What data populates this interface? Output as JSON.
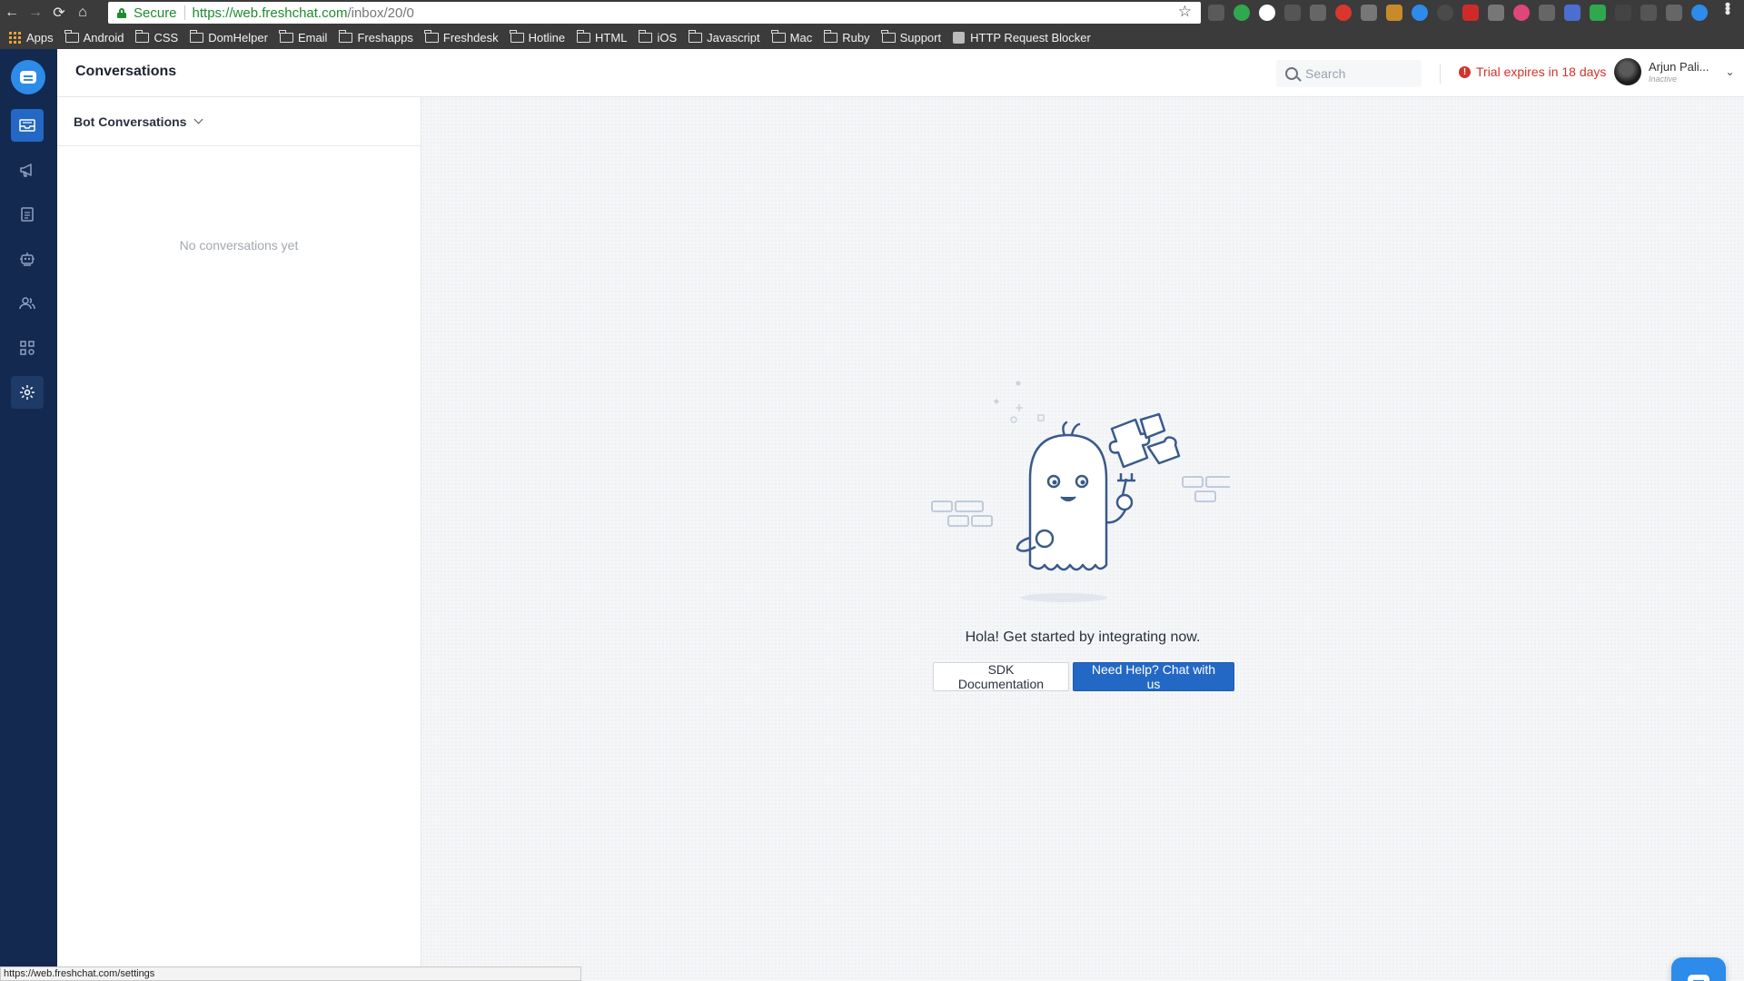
{
  "browser": {
    "secure_label": "Secure",
    "url_host": "https://web.freshchat.com",
    "url_path": "/inbox/20/0",
    "status_url": "https://web.freshchat.com/settings",
    "bookmarks": [
      {
        "label": "Apps",
        "icon": "apps-grid-icon"
      },
      {
        "label": "Android",
        "icon": "folder-icon"
      },
      {
        "label": "CSS",
        "icon": "folder-icon"
      },
      {
        "label": "DomHelper",
        "icon": "folder-icon"
      },
      {
        "label": "Email",
        "icon": "folder-icon"
      },
      {
        "label": "Freshapps",
        "icon": "folder-icon"
      },
      {
        "label": "Freshdesk",
        "icon": "folder-icon"
      },
      {
        "label": "Hotline",
        "icon": "folder-icon"
      },
      {
        "label": "HTML",
        "icon": "folder-icon"
      },
      {
        "label": "iOS",
        "icon": "folder-icon"
      },
      {
        "label": "Javascript",
        "icon": "folder-icon"
      },
      {
        "label": "Mac",
        "icon": "folder-icon"
      },
      {
        "label": "Ruby",
        "icon": "folder-icon"
      },
      {
        "label": "Support",
        "icon": "folder-icon"
      },
      {
        "label": "HTTP Request Blocker",
        "icon": "puzzle-icon"
      }
    ]
  },
  "nav": {
    "items": [
      {
        "name": "inbox",
        "icon": "inbox-icon",
        "active": true
      },
      {
        "name": "campaigns",
        "icon": "megaphone-icon",
        "active": false
      },
      {
        "name": "faq",
        "icon": "document-icon",
        "active": false
      },
      {
        "name": "bots",
        "icon": "bot-icon",
        "active": false
      },
      {
        "name": "contacts",
        "icon": "people-icon",
        "active": false
      },
      {
        "name": "apps",
        "icon": "grid-icon",
        "active": false
      },
      {
        "name": "settings",
        "icon": "gear-icon",
        "active": false
      }
    ]
  },
  "header": {
    "title": "Conversations",
    "search_placeholder": "Search",
    "trial_text": "Trial expires in 18 days",
    "user_name": "Arjun Pali...",
    "user_status": "Inactive"
  },
  "conversations": {
    "filter_label": "Bot Conversations",
    "empty_text": "No conversations yet"
  },
  "main": {
    "hola_text": "Hola! Get started by integrating now.",
    "sdk_button": "SDK Documentation",
    "help_button": "Need Help? Chat with us"
  },
  "colors": {
    "sidebar": "#14294f",
    "accent": "#2368c4",
    "alert": "#d0342c",
    "secure": "#1f8b2e"
  }
}
